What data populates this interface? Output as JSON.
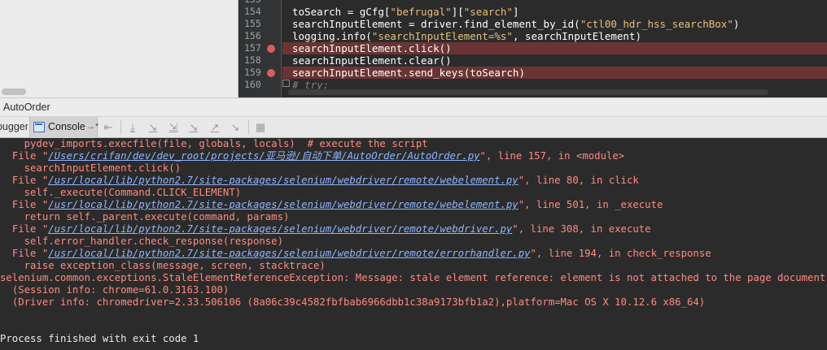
{
  "editor": {
    "lines": [
      {
        "number": "153",
        "code": "",
        "breakpoint": false,
        "highlight": false
      },
      {
        "number": "154",
        "code_prefix": "toSearch = gCfg[",
        "str1": "\"befrugal\"",
        "mid": "][",
        "str2": "\"search\"",
        "code_suffix": "]",
        "breakpoint": false,
        "highlight": false
      },
      {
        "number": "155",
        "code_prefix": "searchInputElement = driver.find_element_by_id(",
        "str1": "\"ctl00_hdr_hss_searchBox\"",
        "code_suffix": ")",
        "breakpoint": false,
        "highlight": false
      },
      {
        "number": "156",
        "code_prefix": "logging.info(",
        "str1": "\"searchInputElement=%s\"",
        "code_suffix": ", searchInputElement)",
        "breakpoint": false,
        "highlight": false
      },
      {
        "number": "157",
        "code": "searchInputElement.click()",
        "breakpoint": true,
        "highlight": true
      },
      {
        "number": "158",
        "code": "searchInputElement.clear()",
        "breakpoint": false,
        "highlight": false
      },
      {
        "number": "159",
        "code": "searchInputElement.send_keys(toSearch)",
        "breakpoint": true,
        "highlight": true
      },
      {
        "number": "160",
        "code": "# try:",
        "breakpoint": false,
        "highlight": false
      }
    ]
  },
  "tool_window": {
    "title": "AutoOrder"
  },
  "toolbar": {
    "debugger_tab": "Debugger",
    "console_tab": "Console",
    "console_pin": "→*"
  },
  "console": {
    "lines": [
      {
        "indent": "    ",
        "text": "pydev_imports.execfile(file, globals, locals)  # execute the script",
        "kind": "plain"
      },
      {
        "indent": "  ",
        "pre": "File \"",
        "path": "/Users/crifan/dev/dev_root/projects/亚马逊/自动下单/AutoOrder/AutoOrder.py",
        "post": "\", line 157, in <module>",
        "kind": "file"
      },
      {
        "indent": "    ",
        "text": "searchInputElement.click()",
        "kind": "plain"
      },
      {
        "indent": "  ",
        "pre": "File \"",
        "path": "/usr/local/lib/python2.7/site-packages/selenium/webdriver/remote/webelement.py",
        "post": "\", line 80, in click",
        "kind": "file"
      },
      {
        "indent": "    ",
        "text": "self._execute(Command.CLICK_ELEMENT)",
        "kind": "plain"
      },
      {
        "indent": "  ",
        "pre": "File \"",
        "path": "/usr/local/lib/python2.7/site-packages/selenium/webdriver/remote/webelement.py",
        "post": "\", line 501, in _execute",
        "kind": "file"
      },
      {
        "indent": "    ",
        "text": "return self._parent.execute(command, params)",
        "kind": "plain"
      },
      {
        "indent": "  ",
        "pre": "File \"",
        "path": "/usr/local/lib/python2.7/site-packages/selenium/webdriver/remote/webdriver.py",
        "post": "\", line 308, in execute",
        "kind": "file"
      },
      {
        "indent": "    ",
        "text": "self.error_handler.check_response(response)",
        "kind": "plain"
      },
      {
        "indent": "  ",
        "pre": "File \"",
        "path": "/usr/local/lib/python2.7/site-packages/selenium/webdriver/remote/errorhandler.py",
        "post": "\", line 194, in check_response",
        "kind": "file"
      },
      {
        "indent": "    ",
        "text": "raise exception_class(message, screen, stacktrace)",
        "kind": "plain"
      },
      {
        "indent": "",
        "text": "selenium.common.exceptions.StaleElementReferenceException: Message: stale element reference: element is not attached to the page document",
        "kind": "plain"
      },
      {
        "indent": "  ",
        "text": "(Session info: chrome=61.0.3163.100)",
        "kind": "plain"
      },
      {
        "indent": "  ",
        "text": "(Driver info: chromedriver=2.33.506106 (8a06c39c4582fbfbab6966dbb1c38a9173bfb1a2),platform=Mac OS X 10.12.6 x86_64)",
        "kind": "plain"
      },
      {
        "indent": "",
        "text": "",
        "kind": "plain"
      },
      {
        "indent": "",
        "text": "",
        "kind": "plain"
      },
      {
        "indent": "",
        "text": "Process finished with exit code 1",
        "kind": "white"
      }
    ]
  },
  "colors": {
    "editor_bg": "#2b2b2b",
    "breakpoint_line": "#6b3434",
    "breakpoint_dot": "#db5c5c",
    "error_text": "#ff8a80",
    "link_text": "#8fb5ff"
  },
  "icons": {
    "console_tab": "console-icon",
    "toolbar": [
      "show-execution-point-icon",
      "step-over-icon",
      "step-into-icon",
      "step-into-my-code-icon",
      "force-step-into-icon",
      "step-out-icon",
      "run-to-cursor-icon",
      "evaluate-expression-icon"
    ]
  }
}
